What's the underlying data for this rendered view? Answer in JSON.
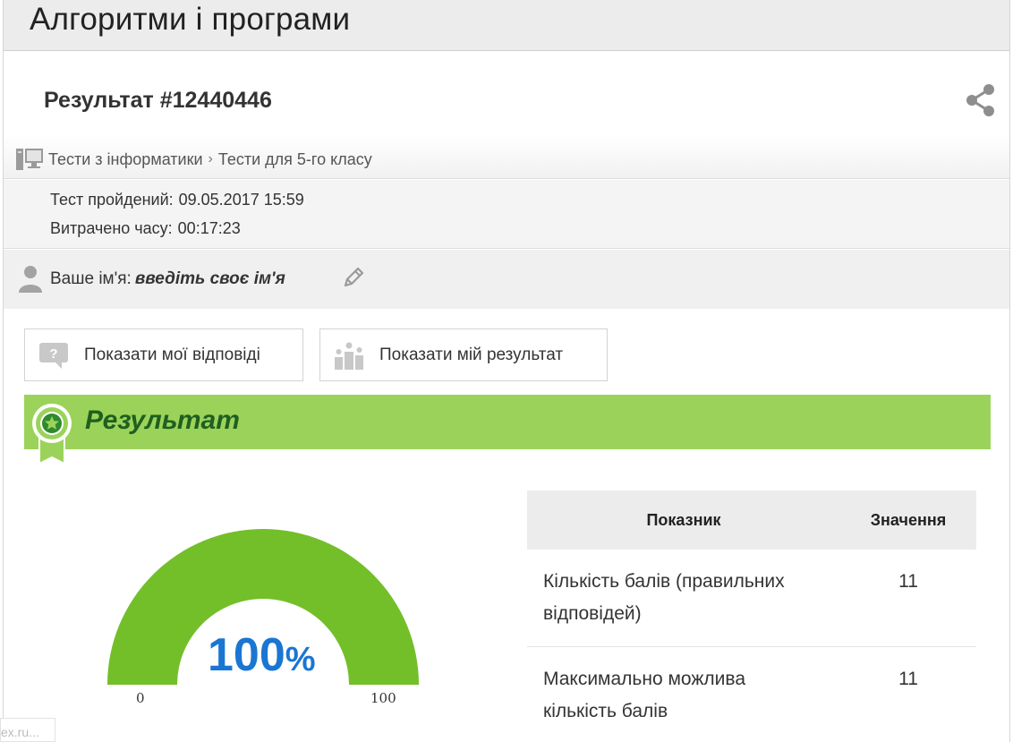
{
  "header": {
    "title": "Алгоритми і програми"
  },
  "result": {
    "title": "Результат #12440446",
    "share_icon": "share-icon"
  },
  "breadcrumb": {
    "icon": "computer-icon",
    "items": [
      "Тести з інформатики",
      "Тести для 5-го класу"
    ],
    "separator": "›"
  },
  "info": {
    "passed_label": "Тест пройдений:",
    "passed_value": "09.05.2017 15:59",
    "time_label": "Витрачено часу:",
    "time_value": "00:17:23"
  },
  "user": {
    "name_label": "Ваше ім'я:",
    "name_value": "введіть своє ім'я",
    "icon": "user-icon",
    "edit_icon": "pencil-icon"
  },
  "buttons": {
    "show_answers": "Показати мої відповіді",
    "show_result": "Показати мій результат"
  },
  "banner": {
    "title": "Результат"
  },
  "gauge": {
    "value": 100,
    "value_text": "100",
    "unit": "%",
    "min": "0",
    "max": "100",
    "color": "#73bf2a"
  },
  "table": {
    "headers": [
      "Показник",
      "Значення"
    ],
    "rows": [
      {
        "label": "Кількість балів (правильних відповідей)",
        "value": "11"
      },
      {
        "label": "Максимально можлива кількість балів",
        "value": "11"
      }
    ]
  },
  "footer": {
    "fragment": "ex.ru..."
  },
  "colors": {
    "banner": "#9bd35a",
    "banner_text": "#1f5f1f",
    "gauge_value": "#1a76d2"
  }
}
